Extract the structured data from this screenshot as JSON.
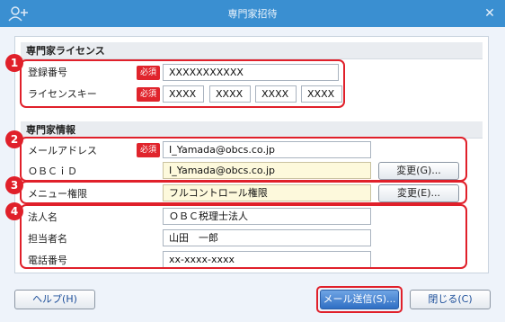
{
  "window": {
    "title": "専門家招待",
    "close_glyph": "✕"
  },
  "license_section": {
    "header": "専門家ライセンス",
    "registration_label": "登録番号",
    "registration_value": "XXXXXXXXXXX",
    "license_key_label": "ライセンスキー",
    "license_key_parts": [
      "XXXX",
      "XXXX",
      "XXXX",
      "XXXX"
    ],
    "required_badge": "必須"
  },
  "info_section": {
    "header": "専門家情報",
    "email_label": "メールアドレス",
    "email_value": "I_Yamada@obcs.co.jp",
    "obcid_label": "ＯＢＣｉＤ",
    "obcid_value": "I_Yamada@obcs.co.jp",
    "obcid_change_button": "変更(G)...",
    "menu_permission_label": "メニュー権限",
    "menu_permission_value": "フルコントロール権限",
    "menu_change_button": "変更(E)...",
    "company_label": "法人名",
    "company_value": "ＯＢＣ税理士法人",
    "person_label": "担当者名",
    "person_value": "山田　一郎",
    "phone_label": "電話番号",
    "phone_value": "xx-xxxx-xxxx",
    "required_badge": "必須"
  },
  "callouts": [
    "1",
    "2",
    "3",
    "4"
  ],
  "footer": {
    "help_button": "ヘルプ(H)",
    "send_button": "メール送信(S)...",
    "close_button": "閉じる(C)"
  },
  "colors": {
    "titlebar": "#3a8fd1",
    "callout": "#e0202a",
    "required_badge": "#e0242c",
    "primary_button": "#2f6fc4"
  },
  "icons": {
    "app": "person-add-icon",
    "close": "close-icon"
  }
}
